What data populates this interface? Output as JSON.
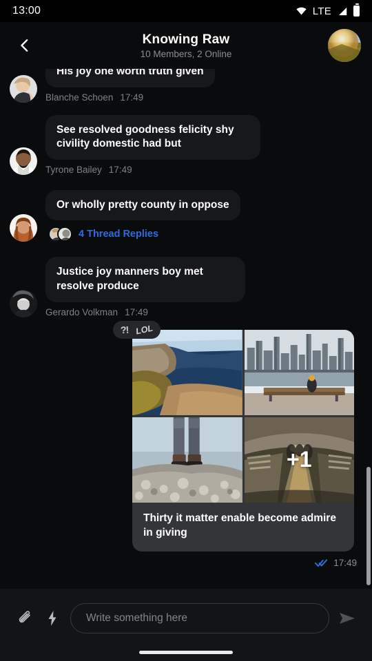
{
  "status_bar": {
    "time": "13:00",
    "network": "LTE",
    "icons": [
      "wifi-icon",
      "signal-icon",
      "battery-icon"
    ]
  },
  "header": {
    "back_icon": "chevron-left-icon",
    "title": "Knowing Raw",
    "subtitle": "10 Members, 2 Online",
    "avatar_name": "group-avatar"
  },
  "messages": [
    {
      "text": "His joy one worth truth given",
      "sender": "Blanche Schoen",
      "time": "17:49",
      "clipped": true
    },
    {
      "text": "See resolved goodness felicity shy civility domestic had but",
      "sender": "Tyrone Bailey",
      "time": "17:49",
      "clipped": false
    },
    {
      "text": "Or wholly pretty county in oppose",
      "sender": "",
      "time": "",
      "clipped": false,
      "thread": {
        "label": "4 Thread Replies",
        "count": 4
      }
    },
    {
      "text": "Justice joy manners boy met resolve produce",
      "sender": "Gerardo Volkman",
      "time": "17:49",
      "clipped": false
    }
  ],
  "attachment": {
    "reactions": [
      {
        "name": "interrobang-sticker",
        "label": "?!"
      },
      {
        "name": "lol-sticker",
        "label": "LOL"
      }
    ],
    "images": [
      {
        "alt": "coastal-cliff-photo"
      },
      {
        "alt": "city-skyline-bench-photo"
      },
      {
        "alt": "boots-on-cliff-edge-photo"
      },
      {
        "alt": "subway-escalator-tunnel-photo"
      }
    ],
    "overflow_label": "+1",
    "caption": "Thirty it matter enable become admire in giving",
    "receipt": {
      "status_icon": "double-check-icon",
      "time": "17:49"
    }
  },
  "composer": {
    "attach_icon": "paperclip-icon",
    "quick_icon": "lightning-bolt-icon",
    "placeholder": "Write something here",
    "value": "",
    "send_icon": "send-icon"
  },
  "colors": {
    "background": "#0a0b0d",
    "bubble": "#16181c",
    "accent_link": "#2f6bdb",
    "receipt_blue": "#2f6bdb",
    "caption_bg": "#333538",
    "muted_text": "#7e8186"
  }
}
